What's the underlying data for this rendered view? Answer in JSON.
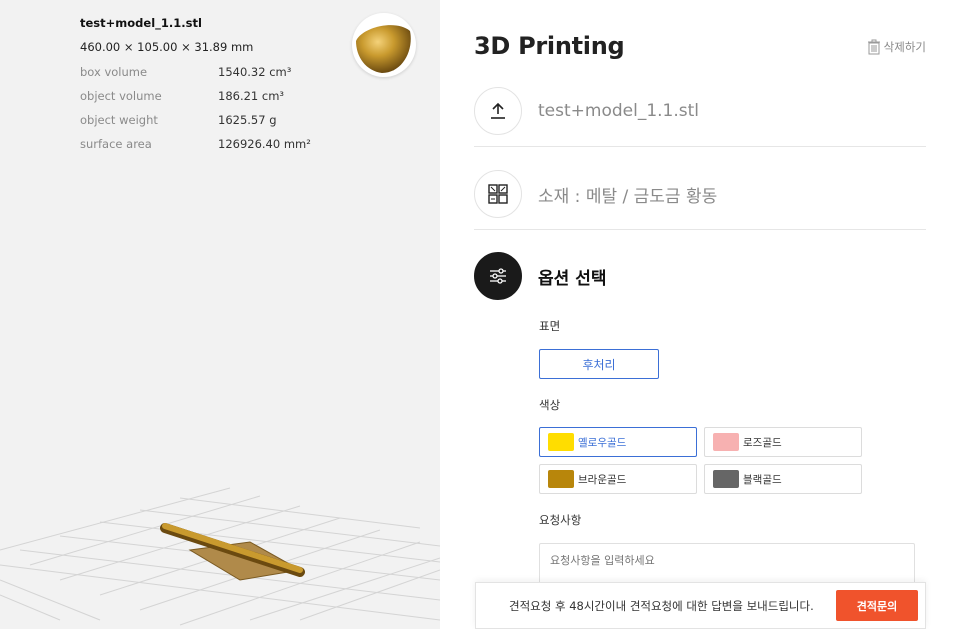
{
  "model": {
    "filename": "test+model_1.1.stl",
    "dimensions": "460.00 × 105.00 × 31.89 mm",
    "stats": [
      {
        "key": "box volume",
        "value": "1540.32 cm³"
      },
      {
        "key": "object volume",
        "value": "186.21 cm³"
      },
      {
        "key": "object weight",
        "value": "1625.57 g"
      },
      {
        "key": "surface area",
        "value": "126926.40 mm²"
      }
    ]
  },
  "panel": {
    "title": "3D Printing",
    "delete_label": "삭제하기"
  },
  "steps": {
    "upload_file": "test+model_1.1.stl",
    "material": "소재 : 메탈 / 금도금 황동",
    "options_title": "옵션 선택"
  },
  "options": {
    "surface_label": "표면",
    "surface_value": "후처리",
    "color_label": "색상",
    "colors": [
      {
        "name": "옐로우골드",
        "hex": "#ffdd00",
        "selected": true
      },
      {
        "name": "로즈골드",
        "hex": "#f7b1b1",
        "selected": false
      },
      {
        "name": "브라운골드",
        "hex": "#b8860b",
        "selected": false
      },
      {
        "name": "블랙골드",
        "hex": "#666666",
        "selected": false
      }
    ],
    "request_label": "요청사항",
    "request_placeholder": "요청사항을 입력하세요"
  },
  "footer": {
    "message": "견적요청 후 48시간이내 견적요청에 대한 답변을 보내드립니다.",
    "button": "견적문의"
  },
  "colors": {
    "accent_blue": "#3b6fd6",
    "cta_orange": "#f0532c",
    "gold": "#c99a2e"
  }
}
